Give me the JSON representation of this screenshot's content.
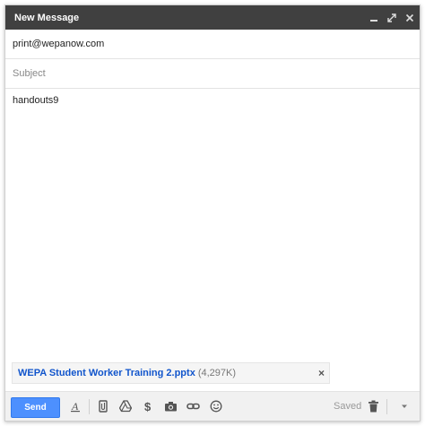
{
  "window": {
    "title": "New Message",
    "minimize_icon": "minimize-icon",
    "popout_icon": "popout-icon",
    "close_icon": "close-icon"
  },
  "recipients": {
    "to_value": "print@wepanow.com"
  },
  "subject": {
    "value": "",
    "placeholder": "Subject"
  },
  "body": {
    "text": "handouts9"
  },
  "attachment": {
    "name": "WEPA Student Worker Training 2.pptx",
    "size": "(4,297K)",
    "remove_icon": "close-icon"
  },
  "toolbar": {
    "send_label": "Send",
    "saved_label": "Saved",
    "icons": [
      "formatting-icon",
      "attach-file-icon",
      "drive-icon",
      "dollar-icon",
      "camera-icon",
      "link-icon",
      "emoji-icon",
      "trash-icon",
      "more-options-icon"
    ]
  },
  "colors": {
    "titlebar": "#404040",
    "send_button": "#4d90fe",
    "attachment_link": "#1155cc"
  }
}
